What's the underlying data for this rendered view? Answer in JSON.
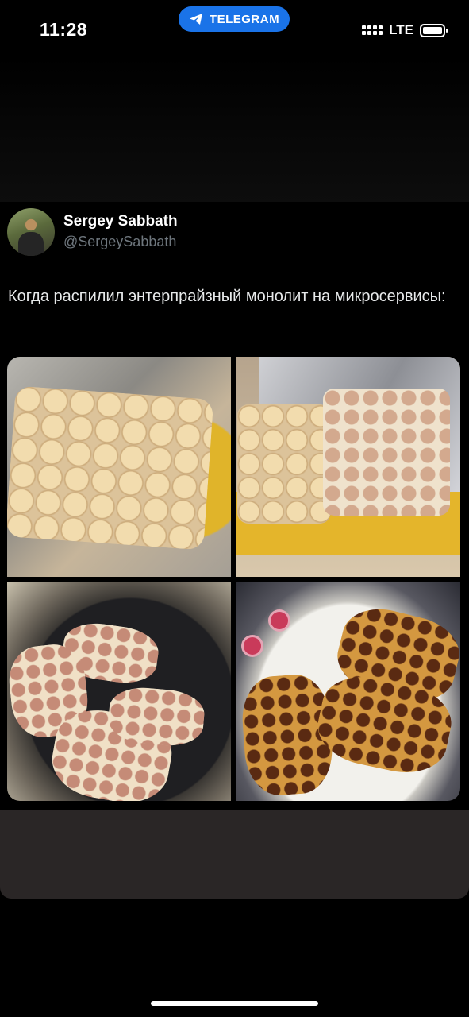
{
  "status_bar": {
    "time": "11:28",
    "app_pill": "TELEGRAM",
    "network": "LTE",
    "pill_color": "#1a73e8"
  },
  "tweet": {
    "author_name": "Sergey Sabbath",
    "author_handle": "@SergeySabbath",
    "text": "Когда распилил энтерпрайзный монолит на микросервисы:"
  },
  "icons": [
    "telegram-plane-icon",
    "signal-icon",
    "battery-icon"
  ]
}
